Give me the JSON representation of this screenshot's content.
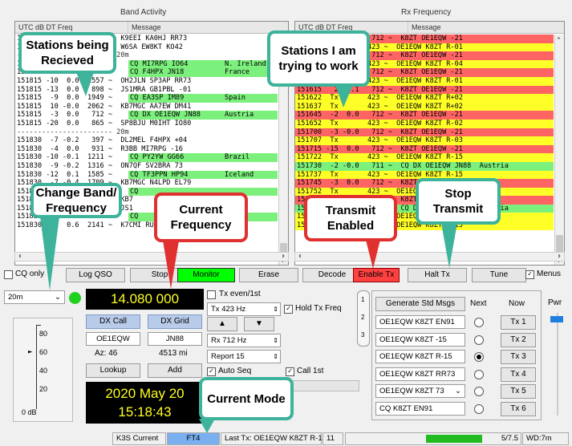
{
  "band_activity": {
    "title": "Band Activity",
    "column_utc": "UTC  dB  DT Freq",
    "column_message": "Message",
    "rows": [
      {
        "c": "",
        "t": "151800  -5  0.3  2000 ~  K9EEI KA0HJ RR73",
        "m": "",
        "country": ""
      },
      {
        "c": "",
        "t": "151800  -8  0.1   455 ~  W6SA EW8KT KO42",
        "m": "",
        "country": ""
      },
      {
        "c": "sep",
        "t": "----------------------- 20m",
        "m": "",
        "country": ""
      },
      {
        "c": "g",
        "t": "151815  -3  0.0   721 ~",
        "m": "CQ MI7RPG IO64",
        "country": "N. Ireland"
      },
      {
        "c": "g",
        "t": "151815  -9  0.1  1013 ~",
        "m": "CQ F4HPX JN18",
        "country": "France"
      },
      {
        "c": "",
        "t": "151815 -10  0.0  1557 ~  OH2JLN SP3AP RR73",
        "m": "",
        "country": ""
      },
      {
        "c": "",
        "t": "151815 -13  0.0   898 ~  JS1MRA GB1PBL -01",
        "m": "",
        "country": ""
      },
      {
        "c": "g",
        "t": "151815  -9  0.0  1949 ~",
        "m": "CQ EA3SP IM89",
        "country": "Spain"
      },
      {
        "c": "",
        "t": "151815  10 -0.0  2062 ~  KB7MGC AA7EW DM41",
        "m": "",
        "country": ""
      },
      {
        "c": "g",
        "t": "151815  -3  0.0   712 ~",
        "m": "CQ DX OE1EQW JN88",
        "country": "Austria"
      },
      {
        "c": "",
        "t": "151815 -20  0.0   865 ~  SP8BJU M0IHT IO80",
        "m": "",
        "country": ""
      },
      {
        "c": "sep",
        "t": "----------------------- 20m",
        "m": "",
        "country": ""
      },
      {
        "c": "",
        "t": "151830  -7 -0.2   397 ~  DL2MEL F4HPX +04",
        "m": "",
        "country": ""
      },
      {
        "c": "",
        "t": "151830  -4  0.0   931 ~  R3BB MI7RPG -16",
        "m": "",
        "country": ""
      },
      {
        "c": "g",
        "t": "151830 -10 -0.1  1211 ~",
        "m": "CQ PY2YW GG66",
        "country": "Brazil"
      },
      {
        "c": "",
        "t": "151830  -9 -0.2  1316 ~  ON7QF SV2BRA 73",
        "m": "",
        "country": ""
      },
      {
        "c": "g",
        "t": "151830 -12  0.1  1585 ~",
        "m": "CQ TF3PPN HP94",
        "country": "Iceland"
      },
      {
        "c": "",
        "t": "151830  -7 -0.4  1709 ~  KB7MGC N4LPD EL79",
        "m": "",
        "country": ""
      },
      {
        "c": "g",
        "t": "151830  -5  0.0  1500 ~",
        "m": "CQ",
        "country": ""
      },
      {
        "c": "",
        "t": "151830  -6  0.0  1800 ~  KB7",
        "m": "",
        "country": ""
      },
      {
        "c": "",
        "t": "151830  -9  0.1  1300 ~  JS1",
        "m": "",
        "country": ""
      },
      {
        "c": "g",
        "t": "151830 -14  0.0  1900 ~",
        "m": "CQ",
        "country": ""
      },
      {
        "c": "",
        "t": "151830 -11  0.6  2141 ~  K7CMI RU3AA  5",
        "m": "",
        "country": ""
      }
    ]
  },
  "rx_frequency": {
    "title": "Rx Frequency",
    "column_utc": "UTC  dB  DT Freq",
    "column_message": "Message",
    "rows": [
      {
        "c": "r",
        "t": "151545  -5  0.0   712 ~  K8ZT OE1EQW -21"
      },
      {
        "c": "y",
        "t": "151600  Tx       423 ~  OE1EQW K8ZT R-01"
      },
      {
        "c": "r",
        "t": "151600  -5  0.0   712 ~  K8ZT OE1EQW -21"
      },
      {
        "c": "y",
        "t": "151600  Tx       423 ~  OE1EQW K8ZT R-04"
      },
      {
        "c": "r",
        "t": "151600  -4  0.0   712 ~  K8ZT OE1EQW -21"
      },
      {
        "c": "y",
        "t": "151607  Tx       423 ~  OE1EQW K8ZT R-01"
      },
      {
        "c": "r",
        "t": "151615   2  0.1   712 ~  K8ZT OE1EQW -21"
      },
      {
        "c": "y",
        "t": "151622  Tx       423 ~  OE1EQW K8ZT R+02"
      },
      {
        "c": "y",
        "t": "151637  Tx       423 ~  OE1EQW K8ZT R+02"
      },
      {
        "c": "r",
        "t": "151645  -2  0.0   712 ~  K8ZT OE1EQW -21"
      },
      {
        "c": "y",
        "t": "151652  Tx       423 ~  OE1EQW K8ZT R-02"
      },
      {
        "c": "r",
        "t": "151700  -3 -0.0   712 ~  K8ZT OE1EQW -21"
      },
      {
        "c": "y",
        "t": "151707  Tx       423 ~  OE1EQW K8ZT R-03"
      },
      {
        "c": "r",
        "t": "151715 -15  0.0   712 ~  K8ZT OE1EQW -21"
      },
      {
        "c": "y",
        "t": "151722  Tx       423 ~  OE1EQW K8ZT R-15"
      },
      {
        "c": "g",
        "t": "151730  -2 -0.0   711 ~  CQ DX OE1EQW JN88  Austria"
      },
      {
        "c": "y",
        "t": "151737  Tx       423 ~  OE1EQW K8ZT R-15"
      },
      {
        "c": "r",
        "t": "151745  -3  0.0   712 ~  K8ZT OE1EQW -21"
      },
      {
        "c": "y",
        "t": "151752  Tx       423 ~  OE1EQW K8ZT R-15"
      },
      {
        "c": "r",
        "t": "151800  -4  0.0   712 ~  K8ZT OE1EQW -21"
      },
      {
        "c": "g",
        "t": "151815  -3  0.0   712 ~  CQ DX OE1EQW JN88  Austria"
      },
      {
        "c": "y",
        "t": "151822  Tx       423 ~  OE1EQW K8ZT R-15"
      },
      {
        "c": "y",
        "t": "151837  Tx       423 ~  OE1EQW K8ZT R-15"
      }
    ]
  },
  "controls": {
    "cq_only": "CQ only",
    "log_qso": "Log QSO",
    "stop": "Stop",
    "monitor": "Monitor",
    "erase": "Erase",
    "decode": "Decode",
    "enable_tx": "Enable Tx",
    "halt_tx": "Halt Tx",
    "tune": "Tune",
    "menus": "Menus"
  },
  "left": {
    "band": "20m",
    "frequency": "14.080 000",
    "dx_call_label": "DX Call",
    "dx_grid_label": "DX Grid",
    "dx_call": "OE1EQW",
    "dx_grid": "JN88",
    "az": "Az: 46",
    "dist": "4513 mi",
    "lookup": "Lookup",
    "add": "Add",
    "date": "2020 May 20",
    "time": "15:18:43",
    "meter_ticks": [
      "80",
      "60",
      "40",
      "20"
    ],
    "meter_unit": "0 dB"
  },
  "mid": {
    "tx_even": "Tx even/1st",
    "tx_hz": "Tx  423  Hz",
    "hold_tx_freq": "Hold Tx Freq",
    "rx_hz": "Rx  712  Hz",
    "report": "Report  15",
    "auto_seq": "Auto Seq",
    "call_1st": "Call 1st",
    "tabs": [
      "1",
      "2",
      "3"
    ]
  },
  "messages": {
    "generate": "Generate Std Msgs",
    "next": "Next",
    "now": "Now",
    "pwr": "Pwr",
    "items": [
      {
        "text": "OE1EQW K8ZT EN91",
        "tx": "Tx 1"
      },
      {
        "text": "OE1EQW K8ZT -15",
        "tx": "Tx 2"
      },
      {
        "text": "OE1EQW K8ZT R-15",
        "tx": "Tx 3"
      },
      {
        "text": "OE1EQW K8ZT RR73",
        "tx": "Tx 4"
      },
      {
        "text": "OE1EQW K8ZT 73",
        "tx": "Tx 5"
      },
      {
        "text": "CQ K8ZT EN91",
        "tx": "Tx 6"
      }
    ]
  },
  "status_bar": {
    "mode_name": "K3S Current",
    "mode": "FT4",
    "last_tx": "Last Tx: OE1EQW K8ZT R-15",
    "count": "11",
    "progress": "5/7.5",
    "wd": "WD:7m"
  },
  "callouts": {
    "stations_received": "Stations being Recieved",
    "stations_working": "Stations I am trying to work",
    "change_band": "Change Band/ Frequency",
    "current_frequency": "Current Frequency",
    "transmit_enabled": "Transmit Enabled",
    "stop_transmit": "Stop Transmit",
    "current_mode": "Current Mode"
  },
  "colors": {
    "cq_green": "#7cf07c",
    "tx_yellow": "#ffff28",
    "call_red": "#ff6464",
    "callout_green": "#3cb39a",
    "callout_red": "#e03030"
  }
}
